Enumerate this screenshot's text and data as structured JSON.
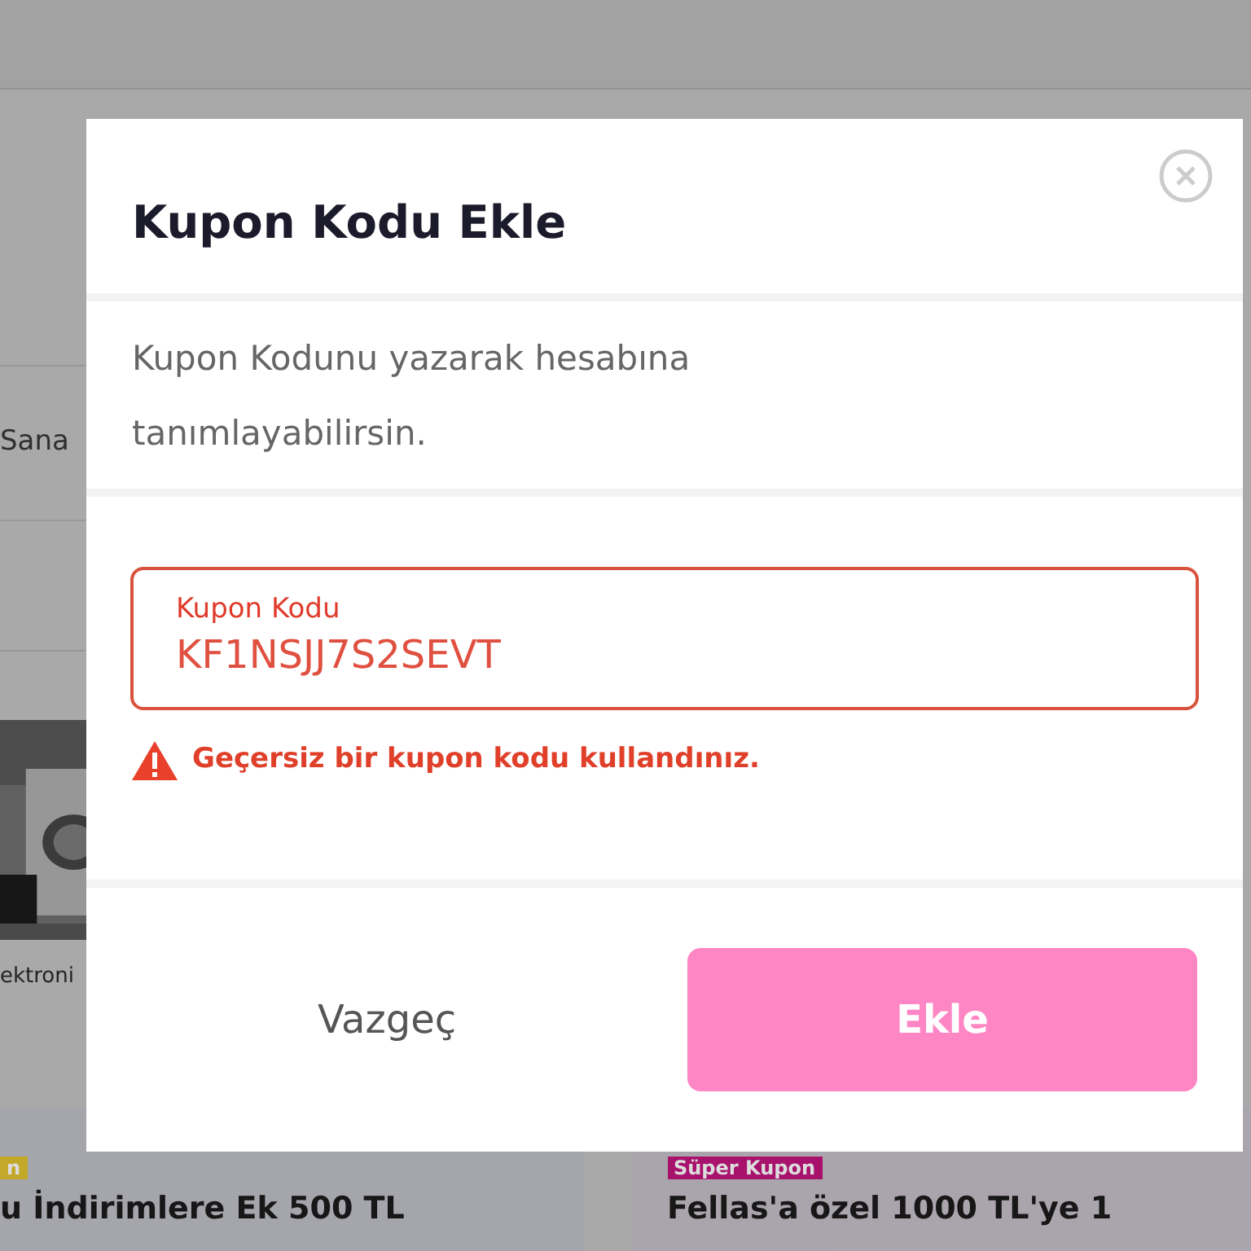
{
  "background": {
    "sidebar_items": [
      "Sana",
      "ektroni"
    ],
    "cards": [
      {
        "badge": "n",
        "color": "#c4a82a",
        "title": "u İndirimlere Ek 500 TL"
      },
      {
        "badge": "Süper Kupon",
        "color": "#a8126c",
        "title": "Fellas'a özel 1000 TL'ye 1"
      }
    ]
  },
  "dialog": {
    "title": "Kupon Kodu Ekle",
    "description": "Kupon Kodunu yazarak hesabına tanımlayabilirsin.",
    "field": {
      "label": "Kupon Kodu",
      "value": "KF1NSJJ7S2SEVT",
      "error": true
    },
    "error_message": "Geçersiz bir kupon kodu kullandınız.",
    "buttons": [
      {
        "kind": "secondary",
        "label": "Vazgeç",
        "disabled": false
      },
      {
        "kind": "primary",
        "label": "Ekle",
        "disabled": true
      }
    ]
  }
}
